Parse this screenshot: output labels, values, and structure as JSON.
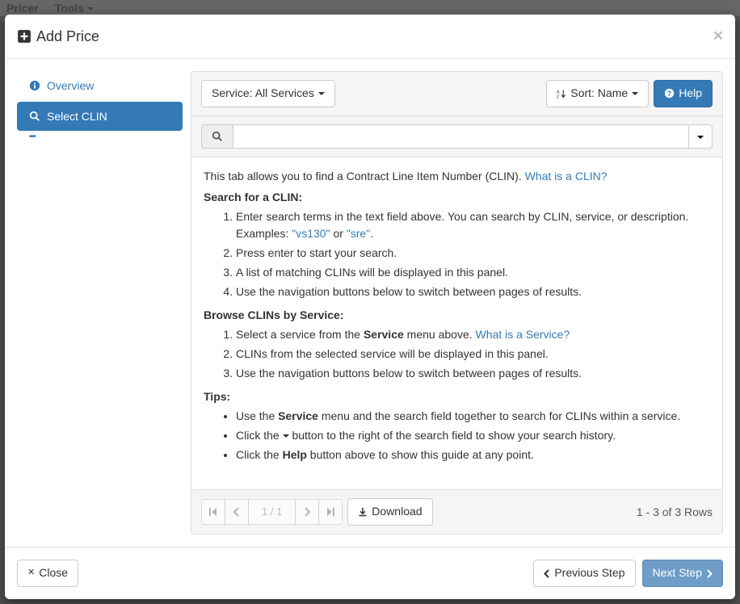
{
  "bg": {
    "brand": "Pricer",
    "tools": "Tools"
  },
  "modal": {
    "title": "Add Price",
    "close_x": "×"
  },
  "sidebar": {
    "overview": "Overview",
    "select_clin": "Select CLIN",
    "more": "•••"
  },
  "toolbar": {
    "service_label": "Service: All Services",
    "sort_label": "Sort: Name",
    "help_label": "Help"
  },
  "search": {
    "placeholder": ""
  },
  "content": {
    "intro_text": "This tab allows you to find a Contract Line Item Number (CLIN). ",
    "intro_link": "What is a CLIN?",
    "search_heading": "Search for a CLIN:",
    "search_steps": [
      {
        "pre": "Enter search terms in the text field above. You can search by CLIN, service, or description. Examples: ",
        "link1": "\"vs130\"",
        "mid": " or ",
        "link2": "\"sre\"",
        "post": "."
      },
      {
        "pre": "Press enter to start your search."
      },
      {
        "pre": "A list of matching CLINs will be displayed in this panel."
      },
      {
        "pre": "Use the navigation buttons below to switch between pages of results."
      }
    ],
    "browse_heading": "Browse CLINs by Service:",
    "browse_steps": [
      {
        "pre": "Select a service from the ",
        "bold": "Service",
        "mid": " menu above. ",
        "link": "What is a Service?"
      },
      {
        "pre": "CLINs from the selected service will be displayed in this panel."
      },
      {
        "pre": "Use the navigation buttons below to switch between pages of results."
      }
    ],
    "tips_heading": "Tips:",
    "tips": [
      {
        "pre": "Use the ",
        "bold": "Service",
        "post": " menu and the search field together to search for CLINs within a service."
      },
      {
        "pre": "Click the ",
        "caret": true,
        "post": " button to the right of the search field to show your search history."
      },
      {
        "pre": "Click the ",
        "bold": "Help",
        "post": " button above to show this guide at any point."
      }
    ]
  },
  "pager": {
    "page_text": "1 / 1",
    "download": "Download",
    "rows_text": "1 - 3 of 3 Rows"
  },
  "footer": {
    "close": "Close",
    "prev": "Previous Step",
    "next": "Next Step"
  }
}
